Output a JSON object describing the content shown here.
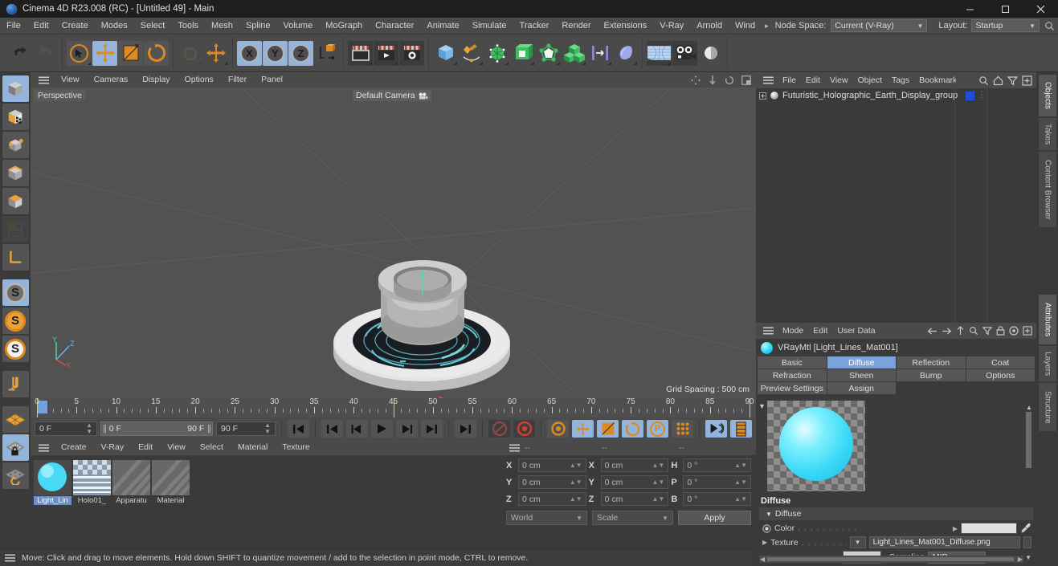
{
  "window": {
    "title": "Cinema 4D R23.008 (RC) - [Untitled 49] - Main",
    "minimize": "—",
    "maximize": "❐",
    "close": "✕"
  },
  "main_menu": {
    "items": [
      "File",
      "Edit",
      "Create",
      "Modes",
      "Select",
      "Tools",
      "Mesh",
      "Spline",
      "Volume",
      "MoGraph",
      "Character",
      "Animate",
      "Simulate",
      "Tracker",
      "Render",
      "Extensions",
      "V-Ray",
      "Arnold",
      "Wind"
    ],
    "overflow_arrow": "▸",
    "node_space_label": "Node Space:",
    "node_space_value": "Current (V-Ray)",
    "layout_label": "Layout:",
    "layout_value": "Startup"
  },
  "toolbar": {
    "undo": "undo",
    "redo": "redo",
    "select": "live-selection",
    "move": "move",
    "scale": "scale",
    "rotate": "rotate",
    "reset_rotate": "reset-rotation",
    "global_move": "global-move",
    "axis_x": "X",
    "axis_y": "Y",
    "axis_z": "Z",
    "world_object": "world-object-axis",
    "render_view": "render-view",
    "render_region": "render-to-picture-viewer",
    "render_settings": "render-settings",
    "cube": "primitive-cube",
    "spline": "spline-pen",
    "generator": "subdivision-surface",
    "deformer": "bend-deformer",
    "scene": "scene-environment",
    "array": "array-cloner",
    "mograph": "mograph",
    "field": "field",
    "sky": "sky-environment",
    "camera": "camera",
    "light": "light"
  },
  "left_tools": {
    "items": [
      {
        "name": "model-mode",
        "active": true
      },
      {
        "name": "texture-mode",
        "active": false
      },
      {
        "name": "point-mode",
        "active": false
      },
      {
        "name": "edge-mode",
        "active": false
      },
      {
        "name": "polygon-mode",
        "active": false
      },
      {
        "name": "workplane-mode",
        "active": false,
        "disabled": true
      },
      {
        "name": "axis-mode",
        "active": false
      },
      {
        "name": "enable-axis",
        "active": true
      },
      {
        "name": "object-axis",
        "active": false
      },
      {
        "name": "world-axis",
        "active": false
      },
      {
        "name": "snap-toggle",
        "active": false
      },
      {
        "name": "workplane",
        "active": false
      },
      {
        "name": "workplane-lock",
        "active": true
      },
      {
        "name": "workplane-rotate",
        "active": false
      }
    ]
  },
  "viewport": {
    "menu": [
      "View",
      "Cameras",
      "Display",
      "Options",
      "Filter",
      "Panel"
    ],
    "label": "Perspective",
    "camera": "Default Camera",
    "grid_spacing": "Grid Spacing : 500 cm",
    "axis_x": "X",
    "axis_y": "Y",
    "axis_z": "Z"
  },
  "timeline": {
    "ticks": [
      0,
      5,
      10,
      15,
      20,
      25,
      30,
      35,
      40,
      45,
      50,
      55,
      60,
      65,
      70,
      75,
      80,
      85,
      90
    ],
    "current_frame": "0 F",
    "range_start": "0 F",
    "range_end": "90 F",
    "max_frame": "90 F",
    "right_frame": "0 F",
    "transport": {
      "go_to_start": "⏮",
      "prev_key": "⏮",
      "prev_frame": "◁",
      "play": "▶",
      "next_frame": "▷",
      "next_key": "⏭",
      "go_to_end": "⏭",
      "record": "record",
      "autokey": "autokey",
      "keyframe_settings": "keyframe-settings",
      "pos": "position-key",
      "scale": "scale-key",
      "rot": "rotation-key",
      "param": "parameter-key",
      "point": "point-level-key",
      "play_mode": "play-mode",
      "level_of_detail": "level-of-detail"
    }
  },
  "material_manager": {
    "menu": [
      "Create",
      "V-Ray",
      "Edit",
      "View",
      "Select",
      "Material",
      "Texture"
    ],
    "materials": [
      {
        "name": "Light_Lin",
        "type": "sphere-blue",
        "selected": true
      },
      {
        "name": "Holo01_",
        "type": "checker-texture",
        "selected": false
      },
      {
        "name": "Apparatu",
        "type": "hatched",
        "selected": false
      },
      {
        "name": "Material",
        "type": "hatched",
        "selected": false
      }
    ]
  },
  "coordinates": {
    "columns": [
      "--",
      "--",
      "--"
    ],
    "rows": [
      {
        "label": "X",
        "pos": "0 cm",
        "label2": "X",
        "size": "0 cm",
        "label3": "H",
        "rot": "0 °"
      },
      {
        "label": "Y",
        "pos": "0 cm",
        "label2": "Y",
        "size": "0 cm",
        "label3": "P",
        "rot": "0 °"
      },
      {
        "label": "Z",
        "pos": "0 cm",
        "label2": "Z",
        "size": "0 cm",
        "label3": "B",
        "rot": "0 °"
      }
    ],
    "system": "World",
    "mode": "Scale",
    "apply": "Apply"
  },
  "status_bar": {
    "text": "Move: Click and drag to move elements. Hold down SHIFT to quantize movement / add to the selection in point mode, CTRL to remove."
  },
  "object_manager": {
    "menu": [
      "File",
      "Edit",
      "View",
      "Object",
      "Tags",
      "Bookmarks"
    ],
    "icons": [
      "search-icon",
      "home-icon",
      "filter-icon",
      "add-icon"
    ],
    "tree": [
      {
        "name": "Futuristic_Holographic_Earth_Display_group",
        "expandable": true,
        "tag_color": "#1b4fd8"
      }
    ]
  },
  "attributes": {
    "menu": [
      "Mode",
      "Edit",
      "User Data"
    ],
    "icons": [
      "back-arrow",
      "forward-arrow",
      "up-arrow",
      "search-icon",
      "filter-icon",
      "lock-icon",
      "record-icon",
      "add-icon"
    ],
    "header": "VRayMtl [Light_Lines_Mat001]",
    "tabs": [
      {
        "label": "Basic",
        "active": false
      },
      {
        "label": "Diffuse",
        "active": true
      },
      {
        "label": "Reflection",
        "active": false
      },
      {
        "label": "Coat",
        "active": false
      },
      {
        "label": "Refraction",
        "active": false
      },
      {
        "label": "Sheen",
        "active": false
      },
      {
        "label": "Bump",
        "active": false
      },
      {
        "label": "Options",
        "active": false
      },
      {
        "label": "Preview Settings",
        "active": false
      },
      {
        "label": "Assign",
        "active": false
      }
    ],
    "section_title": "Diffuse",
    "group_label": "Diffuse",
    "color_label": "Color",
    "color_dots": ". . . . . . . . . .",
    "color_value": "#e0e0e0",
    "eyedropper": "eyedropper-icon",
    "texture_label": "Texture",
    "texture_dots": ". . . . . . . . . .",
    "texture_value": "Light_Lines_Mat001_Diffuse.png",
    "sampling_label": "Sampling",
    "sampling_value": "MIP"
  },
  "dock_tabs": {
    "top": [
      "Objects",
      "Takes",
      "Content Browser"
    ],
    "bottom": [
      "Attributes",
      "Layers",
      "Structure"
    ],
    "active_top": "Objects",
    "active_bottom": "Attributes"
  },
  "colors": {
    "accent_orange": "#e08a1e",
    "accent_blue": "#93b4dc",
    "panel_bg": "#3a3a3a",
    "toolbar_bg": "#4a4a4a",
    "viewport_bg": "#525252",
    "material_cyan": "#38d9f7",
    "tag_blue": "#1b4fd8"
  }
}
